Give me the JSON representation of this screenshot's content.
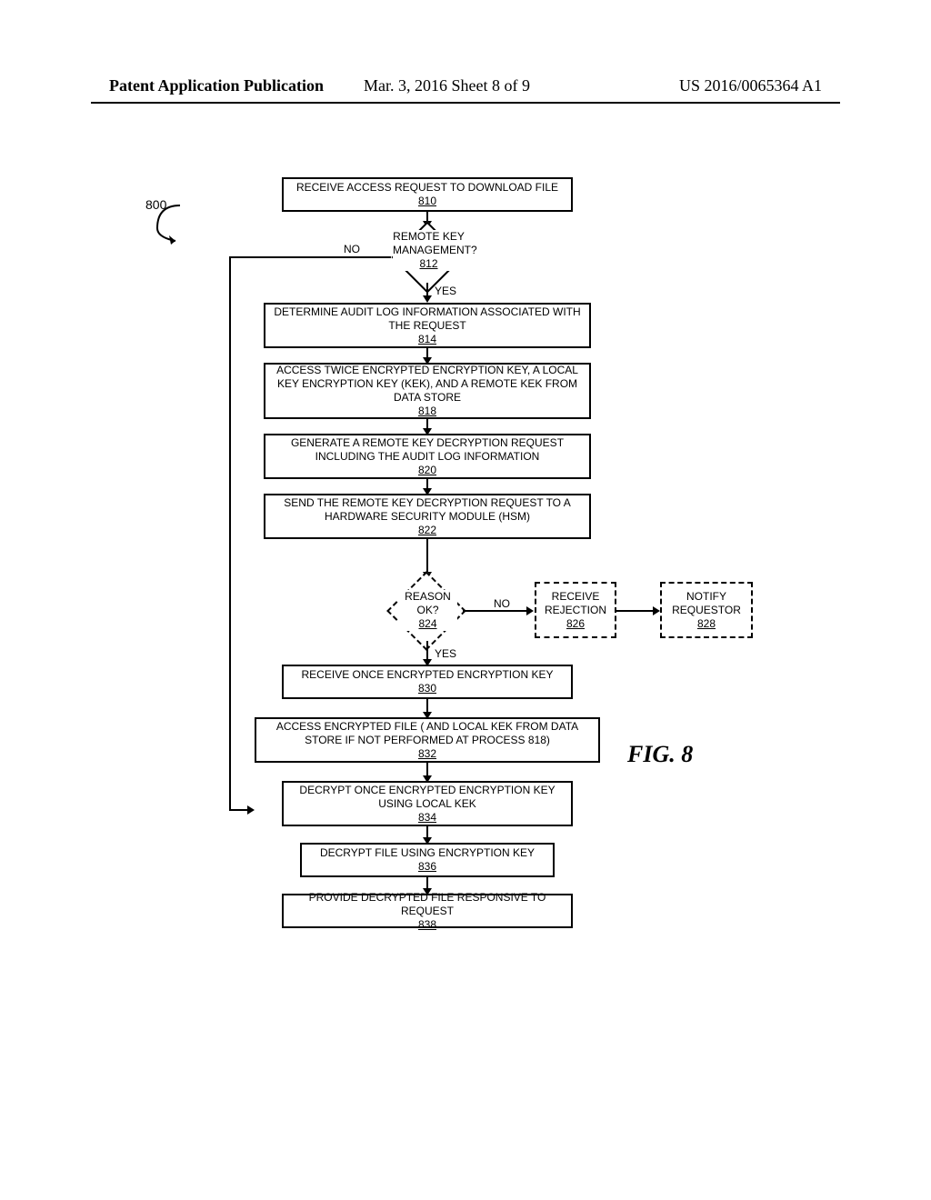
{
  "header": {
    "left": "Patent Application Publication",
    "mid": "Mar. 3, 2016  Sheet 8 of 9",
    "right": "US 2016/0065364 A1"
  },
  "ref_label": "800",
  "figure_label": "FIG. 8",
  "steps": {
    "s810": {
      "text": "RECEIVE ACCESS REQUEST TO DOWNLOAD FILE",
      "ref": "810"
    },
    "s812": {
      "text": "REMOTE KEY MANAGEMENT?",
      "ref": "812"
    },
    "s814": {
      "text": "DETERMINE AUDIT LOG INFORMATION ASSOCIATED WITH THE REQUEST",
      "ref": "814"
    },
    "s818": {
      "text": "ACCESS TWICE ENCRYPTED ENCRYPTION KEY, A LOCAL KEY ENCRYPTION KEY (KEK), AND A REMOTE KEK FROM DATA STORE",
      "ref": "818"
    },
    "s820": {
      "text": "GENERATE A REMOTE KEY DECRYPTION REQUEST INCLUDING THE AUDIT LOG INFORMATION",
      "ref": "820"
    },
    "s822": {
      "text": "SEND THE REMOTE KEY DECRYPTION REQUEST TO A HARDWARE SECURITY MODULE (HSM)",
      "ref": "822"
    },
    "s824": {
      "text": "REASON OK?",
      "ref": "824"
    },
    "s826": {
      "text": "RECEIVE REJECTION",
      "ref": "826"
    },
    "s828": {
      "text": "NOTIFY REQUESTOR",
      "ref": "828"
    },
    "s830": {
      "text": "RECEIVE ONCE ENCRYPTED ENCRYPTION KEY",
      "ref": "830"
    },
    "s832": {
      "text": "ACCESS ENCRYPTED FILE ( AND LOCAL KEK FROM DATA STORE IF NOT PERFORMED AT PROCESS 818)",
      "ref": "832"
    },
    "s834": {
      "text": "DECRYPT ONCE ENCRYPTED ENCRYPTION KEY USING LOCAL KEK",
      "ref": "834"
    },
    "s836": {
      "text": "DECRYPT FILE USING ENCRYPTION KEY",
      "ref": "836"
    },
    "s838": {
      "text": "PROVIDE DECRYPTED FILE RESPONSIVE TO REQUEST",
      "ref": "838"
    }
  },
  "edges": {
    "no": "NO",
    "yes": "YES"
  }
}
